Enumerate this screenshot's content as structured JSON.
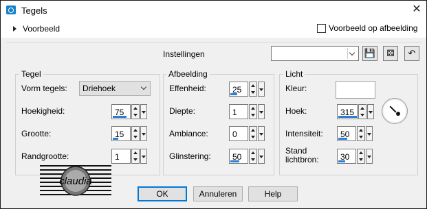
{
  "window": {
    "title": "Tegels"
  },
  "preview": {
    "label": "Voorbeeld",
    "checkbox_label": "Voorbeeld op afbeelding"
  },
  "settings": {
    "label": "Instellingen",
    "value": ""
  },
  "tegel": {
    "title": "Tegel",
    "shape_label": "Vorm tegels:",
    "shape_value": "Driehoek",
    "rows": [
      {
        "label": "Hoekigheid:",
        "value": "75",
        "fill": 0.75
      },
      {
        "label": "Grootte:",
        "value": "15",
        "fill": 0.3
      },
      {
        "label": "Randgrootte:",
        "value": "1",
        "fill": 0.0
      }
    ]
  },
  "afbeelding": {
    "title": "Afbeelding",
    "rows": [
      {
        "label": "Effenheid:",
        "value": "25",
        "fill": 0.25
      },
      {
        "label": "Diepte:",
        "value": "1",
        "fill": 0.0
      },
      {
        "label": "Ambiance:",
        "value": "0",
        "fill": 0.0
      },
      {
        "label": "Glinstering:",
        "value": "50",
        "fill": 0.5
      }
    ]
  },
  "licht": {
    "title": "Licht",
    "color_label": "Kleur:",
    "color_value": "#ffffff",
    "rows": [
      {
        "label": "Hoek:",
        "value": "315",
        "fill": 0.875
      },
      {
        "label": "Intensiteit:",
        "value": "50",
        "fill": 0.5
      },
      {
        "label": "Stand lichtbron:",
        "value": "30",
        "fill": 0.3
      }
    ]
  },
  "buttons": {
    "ok": "OK",
    "cancel": "Annuleren",
    "help": "Help"
  },
  "watermark": "claudia",
  "accent_color": "#0078d7"
}
